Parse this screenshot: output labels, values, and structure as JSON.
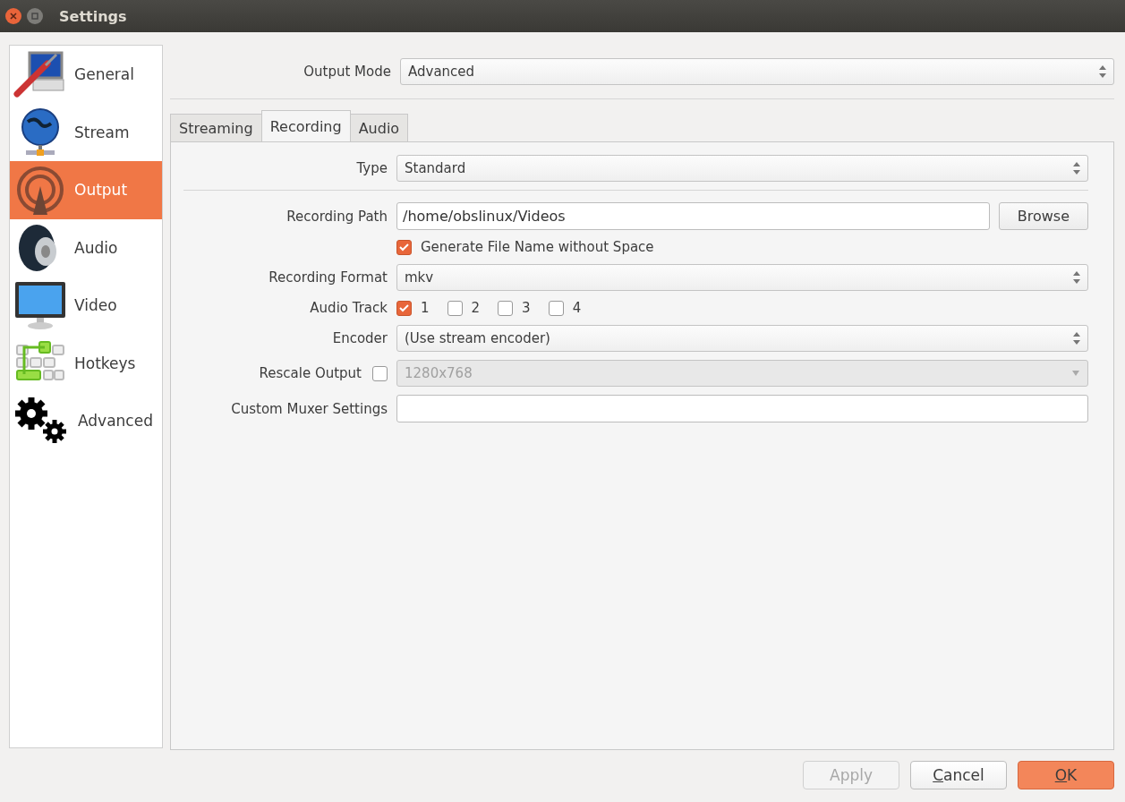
{
  "window": {
    "title": "Settings"
  },
  "sidebar": {
    "items": [
      {
        "label": "General",
        "selected": false
      },
      {
        "label": "Stream",
        "selected": false
      },
      {
        "label": "Output",
        "selected": true
      },
      {
        "label": "Audio",
        "selected": false
      },
      {
        "label": "Video",
        "selected": false
      },
      {
        "label": "Hotkeys",
        "selected": false
      },
      {
        "label": "Advanced",
        "selected": false
      }
    ]
  },
  "output_mode": {
    "label": "Output Mode",
    "value": "Advanced"
  },
  "tabs": [
    {
      "label": "Streaming",
      "selected": false
    },
    {
      "label": "Recording",
      "selected": true
    },
    {
      "label": "Audio",
      "selected": false
    }
  ],
  "recording": {
    "type": {
      "label": "Type",
      "value": "Standard"
    },
    "fields": [
      {
        "kind": "path",
        "label": "Recording Path",
        "value": "/home/obslinux/Videos",
        "button": "Browse"
      },
      {
        "kind": "checkbox",
        "label": "Generate File Name without Space",
        "checked": true
      },
      {
        "kind": "select",
        "label": "Recording Format",
        "value": "mkv"
      },
      {
        "kind": "tracks",
        "label": "Audio Track",
        "tracks": [
          {
            "label": "1",
            "checked": true
          },
          {
            "label": "2",
            "checked": false
          },
          {
            "label": "3",
            "checked": false
          },
          {
            "label": "4",
            "checked": false
          }
        ]
      },
      {
        "kind": "select",
        "label": "Encoder",
        "value": "(Use stream encoder)"
      },
      {
        "kind": "rescale",
        "label": "Rescale Output",
        "checked": false,
        "value": "1280x768",
        "disabled": true
      },
      {
        "kind": "text",
        "label": "Custom Muxer Settings"
      }
    ]
  },
  "buttons": [
    {
      "label": "Apply",
      "disabled": true,
      "default": false,
      "mnemonic": false
    },
    {
      "label": "Cancel",
      "disabled": false,
      "default": false,
      "mnemonic": true
    },
    {
      "label": "OK",
      "disabled": false,
      "default": true,
      "mnemonic": true
    }
  ]
}
